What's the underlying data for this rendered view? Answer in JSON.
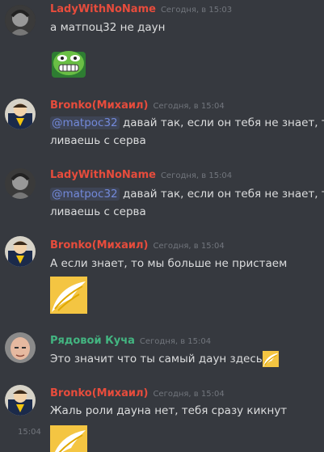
{
  "colors": {
    "background": "#36393f",
    "name_red": "#e74c3c",
    "name_green": "#43b581",
    "mention": "#7289da",
    "timestamp": "#72767d"
  },
  "messages": [
    {
      "author": "LadyWithNoName",
      "time": "Сегодня, в 15:03",
      "lines": [
        "а матпоц32 не даун"
      ],
      "attachment": "pepe-emoji-icon"
    },
    {
      "author": "Bronko(Михаил)",
      "time": "Сегодня, в 15:04",
      "mention": "@matpoc32",
      "lines": [
        "давай так, если он тебя не знает, то",
        "ливаешь с серва"
      ]
    },
    {
      "author": "LadyWithNoName",
      "time": "Сегодня, в 15:04",
      "mention": "@matpoc32",
      "lines": [
        "давай так, если он тебя не знает, то",
        "ливаешь с серва"
      ]
    },
    {
      "author": "Bronko(Михаил)",
      "time": "Сегодня, в 15:04",
      "lines": [
        "А если знает, то мы больше не пристаем"
      ],
      "attachment": "wing-emoji-icon"
    },
    {
      "author": "Рядовой Куча",
      "time": "Сегодня, в 15:04",
      "lines": [
        "Это значит что ты самый даун здесь"
      ]
    },
    {
      "author": "Bronko(Михаил)",
      "time": "Сегодня, в 15:04",
      "lines": [
        "Жаль роли дауна нет, тебя сразу кикнут"
      ],
      "hover_time": "15:04"
    }
  ]
}
